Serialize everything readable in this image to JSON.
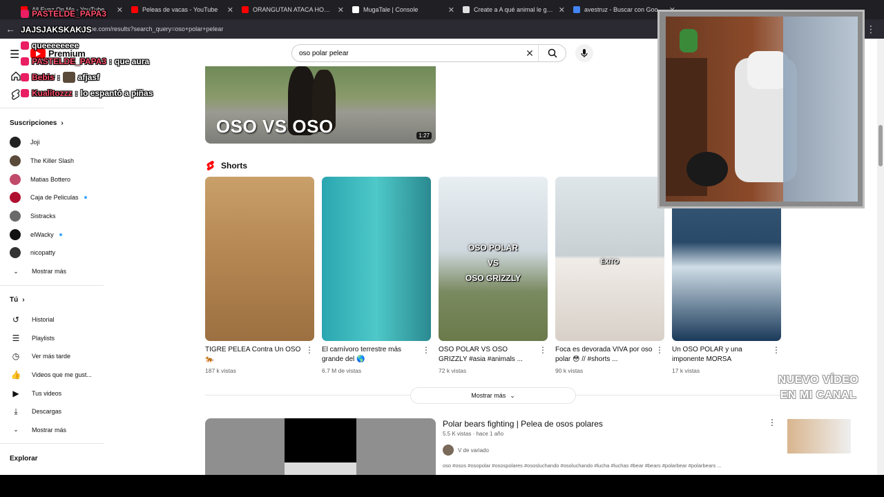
{
  "browser": {
    "tabs": [
      {
        "title": "All Eyez On Me - YouTube",
        "color": "#ff0000"
      },
      {
        "title": "Peleas de vacas - YouTube",
        "color": "#ff0000"
      },
      {
        "title": "ORANGUTAN ATACA HOMBRE",
        "color": "#ff0000"
      },
      {
        "title": "MugaTale | Console",
        "color": "#ffffff"
      },
      {
        "title": "Create a A qué animal le ganar",
        "color": "#e0e0e0"
      },
      {
        "title": "avestruz - Buscar con Google",
        "color": "#4285f4"
      }
    ],
    "url": "youtube.com/results?search_query=oso+polar+pelear"
  },
  "header": {
    "logo_text": "Premium",
    "search_value": "oso polar pelear"
  },
  "sidebar": {
    "main": [
      {
        "label": "Principal",
        "icon": "home-icon"
      },
      {
        "label": "Shorts",
        "icon": "shorts-icon"
      }
    ],
    "subscriptions_title": "Suscripciones",
    "subscriptions": [
      {
        "label": "Joji",
        "color": "#222222",
        "dot": false
      },
      {
        "label": "The Killer Slash",
        "color": "#5a4a3a",
        "dot": false
      },
      {
        "label": "Matias Bottero",
        "color": "#c04a6a",
        "dot": false
      },
      {
        "label": "Caja de Peliculas",
        "color": "#b01030",
        "dot": true
      },
      {
        "label": "Sistracks",
        "color": "#6a6a6a",
        "dot": false
      },
      {
        "label": "elWacky",
        "color": "#111111",
        "dot": true
      },
      {
        "label": "nicopatty",
        "color": "#333333",
        "dot": false
      }
    ],
    "subs_more": "Mostrar más",
    "you_title": "Tú",
    "you": [
      {
        "label": "Historial",
        "icon": "history-icon",
        "glyph": "↺"
      },
      {
        "label": "Playlists",
        "icon": "playlists-icon",
        "glyph": "☰"
      },
      {
        "label": "Ver más tarde",
        "icon": "watch-later-icon",
        "glyph": "◷"
      },
      {
        "label": "Videos que me gust...",
        "icon": "like-icon",
        "glyph": "👍"
      },
      {
        "label": "Tus videos",
        "icon": "your-videos-icon",
        "glyph": "▶"
      },
      {
        "label": "Descargas",
        "icon": "download-icon",
        "glyph": "⤓"
      }
    ],
    "you_more": "Mostrar más",
    "explore_title": "Explorar"
  },
  "top_video": {
    "overlay_text": "OSO VS OSO",
    "duration": "1:27"
  },
  "shorts": {
    "title": "Shorts",
    "items": [
      {
        "title": "TIGRE PELEA Contra Un OSO 🐅",
        "views": "187 k vistas",
        "bg": "linear-gradient(180deg,#c9a06a 0%,#b88a55 40%,#9c7040 100%)",
        "caption": ""
      },
      {
        "title": "El carnívoro terrestre más grande del 🌎",
        "views": "6.7 M de vistas",
        "bg": "linear-gradient(90deg,#2aa6b0 0%,#4ec8c8 50%,#2a8a90 100%)",
        "caption": ""
      },
      {
        "title": "OSO POLAR VS OSO GRIZZLY #asia #animals ...",
        "views": "72 k vistas",
        "bg": "linear-gradient(180deg,#e8eef2 0%,#cfd8de 45%,#7a8a60 70%,#6a7a4a 100%)",
        "caption": "OSO POLAR\nVS\nOSO GRIZZLY"
      },
      {
        "title": "Foca es devorada VIVA por oso polar 😳 // #shorts ...",
        "views": "90 k vistas",
        "bg": "linear-gradient(180deg,#dfe6ea 0%,#c8d0d4 48%,#f0ece8 50%,#d8d0c8 100%)",
        "caption": "ÉXITO"
      },
      {
        "title": "Un OSO POLAR y una imponente MORSA",
        "views": "17 k vistas",
        "bg": "linear-gradient(180deg,#3a5a7a 0%,#2a4a6a 40%,#cfdde6 55%,#1a3a5a 100%)",
        "caption": ""
      }
    ],
    "more_label": "Mostrar más"
  },
  "video": {
    "title": "Polar bears fighting | Pelea de osos polares",
    "meta": "5.5 K vistas · hace 1 año",
    "channel": "V de variado",
    "tags": "oso #osos #osopolar #osospolares #ososluchando #osoluchando #lucha #luchas #bear #bears #polarbear #polarbears ..."
  },
  "stream_chat": [
    {
      "user": "JAJSJAKSKAKJS",
      "msg": ""
    },
    {
      "user": "",
      "msg": "queeeeeeee"
    },
    {
      "user": "PASTELDE_PAPA3",
      "msg": "que aura"
    },
    {
      "user": "Bebis",
      "msg": "afjasf"
    },
    {
      "user": "Kualitozzz",
      "msg": "lo espantó a piñas"
    }
  ],
  "chat_top_user": "PASTELDE_PAPA3",
  "promo_text": "NUEVO VÍDEO\nEN MI CANAL"
}
